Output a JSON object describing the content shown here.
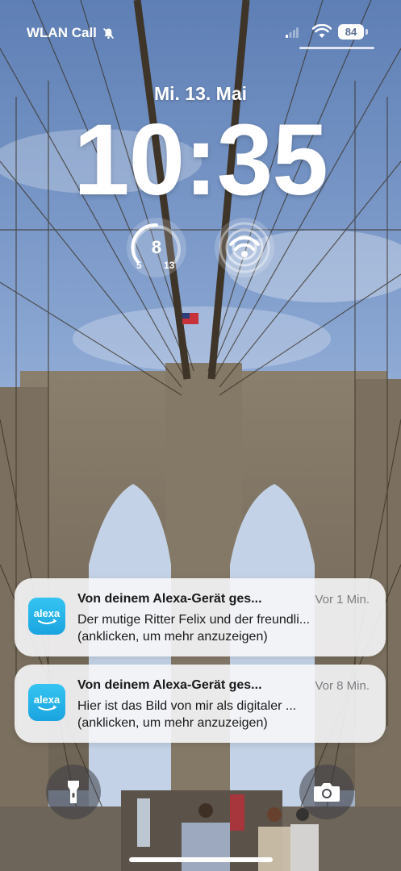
{
  "status_bar": {
    "carrier": "WLAN Call",
    "battery": "84"
  },
  "lockscreen": {
    "date": "Mi. 13. Mai",
    "time": "10:35"
  },
  "widgets": {
    "weather": {
      "temp": "8",
      "low": "5",
      "high": "13"
    }
  },
  "notifications": [
    {
      "title": "Von deinem Alexa-Gerät ges...",
      "time": "Vor 1 Min.",
      "line1": "Der mutige Ritter Felix und der freundli...",
      "line2": "(anklicken, um mehr anzuzeigen)",
      "app_icon": "alexa-app-icon",
      "app_label": "alexa"
    },
    {
      "title": "Von deinem Alexa-Gerät ges...",
      "time": "Vor 8 Min.",
      "line1": "Hier ist das Bild von mir als digitaler ...",
      "line2": "(anklicken, um mehr anzuzeigen)",
      "app_icon": "alexa-app-icon",
      "app_label": "alexa"
    }
  ],
  "quick_actions": {
    "left": "flashlight-icon",
    "right": "camera-icon"
  },
  "colors": {
    "alexa": "#1aa4e0",
    "sky": "#6f8fbf"
  }
}
